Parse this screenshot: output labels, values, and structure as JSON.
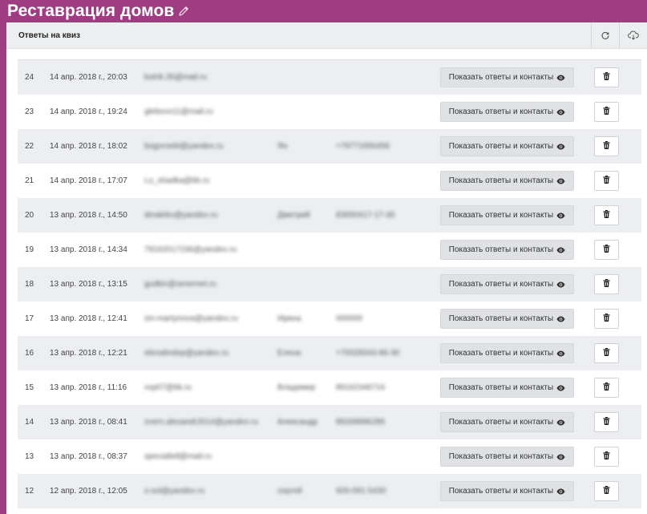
{
  "page": {
    "title": "Реставрация домов",
    "accent_color": "#a03d82"
  },
  "panel": {
    "title": "Ответы на квиз",
    "header_icons": [
      "refresh-icon",
      "cloud-download-icon"
    ]
  },
  "show_label": "Показать ответы и контакты",
  "rows": [
    {
      "num": "24",
      "date": "14 апр. 2018 г., 20:03",
      "email": "kotrik.35@mail.ru",
      "name": "",
      "phone": ""
    },
    {
      "num": "23",
      "date": "14 апр. 2018 г., 19:24",
      "email": "glebovo11@mail.ru",
      "name": "",
      "phone": ""
    },
    {
      "num": "22",
      "date": "14 апр. 2018 г., 18:02",
      "email": "bogoroekt@yandex.ru",
      "name": "Ян",
      "phone": "+79771656456"
    },
    {
      "num": "21",
      "date": "14 апр. 2018 г., 17:07",
      "email": "Lo_shadka@bk.ru",
      "name": "",
      "phone": ""
    },
    {
      "num": "20",
      "date": "13 апр. 2018 г., 14:50",
      "email": "dmalekv@yandex.ru",
      "name": "Дмитрий",
      "phone": "83650417-17-30"
    },
    {
      "num": "19",
      "date": "13 апр. 2018 г., 14:34",
      "email": "79162017236@yandex.ru",
      "name": "",
      "phone": ""
    },
    {
      "num": "18",
      "date": "13 апр. 2018 г., 13:15",
      "email": "gudkin@severnet.ru",
      "name": "",
      "phone": ""
    },
    {
      "num": "17",
      "date": "13 апр. 2018 г., 12:41",
      "email": "zin-martynova@yandex.ru",
      "name": "Ирина",
      "phone": "000000"
    },
    {
      "num": "16",
      "date": "13 апр. 2018 г., 12:21",
      "email": "elenalindop@yandex.ru",
      "name": "Елена",
      "phone": "+70028343-86-30"
    },
    {
      "num": "15",
      "date": "13 апр. 2018 г., 11:16",
      "email": "vvp07@bk.ru",
      "name": "Владимир",
      "phone": "89162346716"
    },
    {
      "num": "14",
      "date": "13 апр. 2018 г., 08:41",
      "email": "zvern.alexandr2014@yandex.ru",
      "name": "Александр",
      "phone": "89268896286"
    },
    {
      "num": "13",
      "date": "13 апр. 2018 г., 08:37",
      "email": "specialtell@mail.ru",
      "name": "",
      "phone": ""
    },
    {
      "num": "12",
      "date": "12 апр. 2018 г., 12:05",
      "email": "s-sol@yandex.ru",
      "name": "сергей",
      "phone": "926-091-5430"
    }
  ]
}
